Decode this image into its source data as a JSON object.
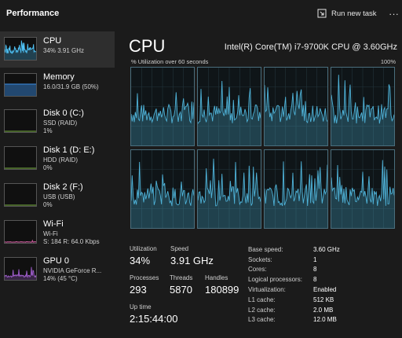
{
  "header": {
    "title": "Performance",
    "run_new_task": "Run new task",
    "more": "..."
  },
  "sidebar": {
    "items": [
      {
        "name": "CPU",
        "sub1": "34%  3.91 GHz",
        "sub2": "",
        "color": "#4fc3f7"
      },
      {
        "name": "Memory",
        "sub1": "16.0/31.9 GB (50%)",
        "sub2": "",
        "color": "#3a8ee6"
      },
      {
        "name": "Disk 0 (C:)",
        "sub1": "SSD (RAID)",
        "sub2": "1%",
        "color": "#7cb342"
      },
      {
        "name": "Disk 1 (D: E:)",
        "sub1": "HDD (RAID)",
        "sub2": "0%",
        "color": "#7cb342"
      },
      {
        "name": "Disk 2 (F:)",
        "sub1": "USB (USB)",
        "sub2": "0%",
        "color": "#7cb342"
      },
      {
        "name": "Wi-Fi",
        "sub1": "Wi-Fi",
        "sub2": "S: 184 R: 64.0 Kbps",
        "color": "#d05fa0"
      },
      {
        "name": "GPU 0",
        "sub1": "NVIDIA GeForce R...",
        "sub2": "14%  (45 °C)",
        "color": "#a25fd0"
      }
    ]
  },
  "main": {
    "title": "CPU",
    "model": "Intel(R) Core(TM) i7-9700K CPU @ 3.60GHz",
    "util_label": "% Utilization over 60 seconds",
    "util_max": "100%",
    "graph_color": "#4fb3d9",
    "core_count_graphs": 8
  },
  "stats": {
    "utilization_label": "Utilization",
    "utilization": "34%",
    "speed_label": "Speed",
    "speed": "3.91 GHz",
    "processes_label": "Processes",
    "processes": "293",
    "threads_label": "Threads",
    "threads": "5870",
    "handles_label": "Handles",
    "handles": "180899",
    "uptime_label": "Up time",
    "uptime": "2:15:44:00"
  },
  "specs": [
    {
      "k": "Base speed:",
      "v": "3.60 GHz"
    },
    {
      "k": "Sockets:",
      "v": "1"
    },
    {
      "k": "Cores:",
      "v": "8"
    },
    {
      "k": "Logical processors:",
      "v": "8"
    },
    {
      "k": "Virtualization:",
      "v": "Enabled"
    },
    {
      "k": "L1 cache:",
      "v": "512 KB"
    },
    {
      "k": "L2 cache:",
      "v": "2.0 MB"
    },
    {
      "k": "L3 cache:",
      "v": "12.0 MB"
    }
  ]
}
